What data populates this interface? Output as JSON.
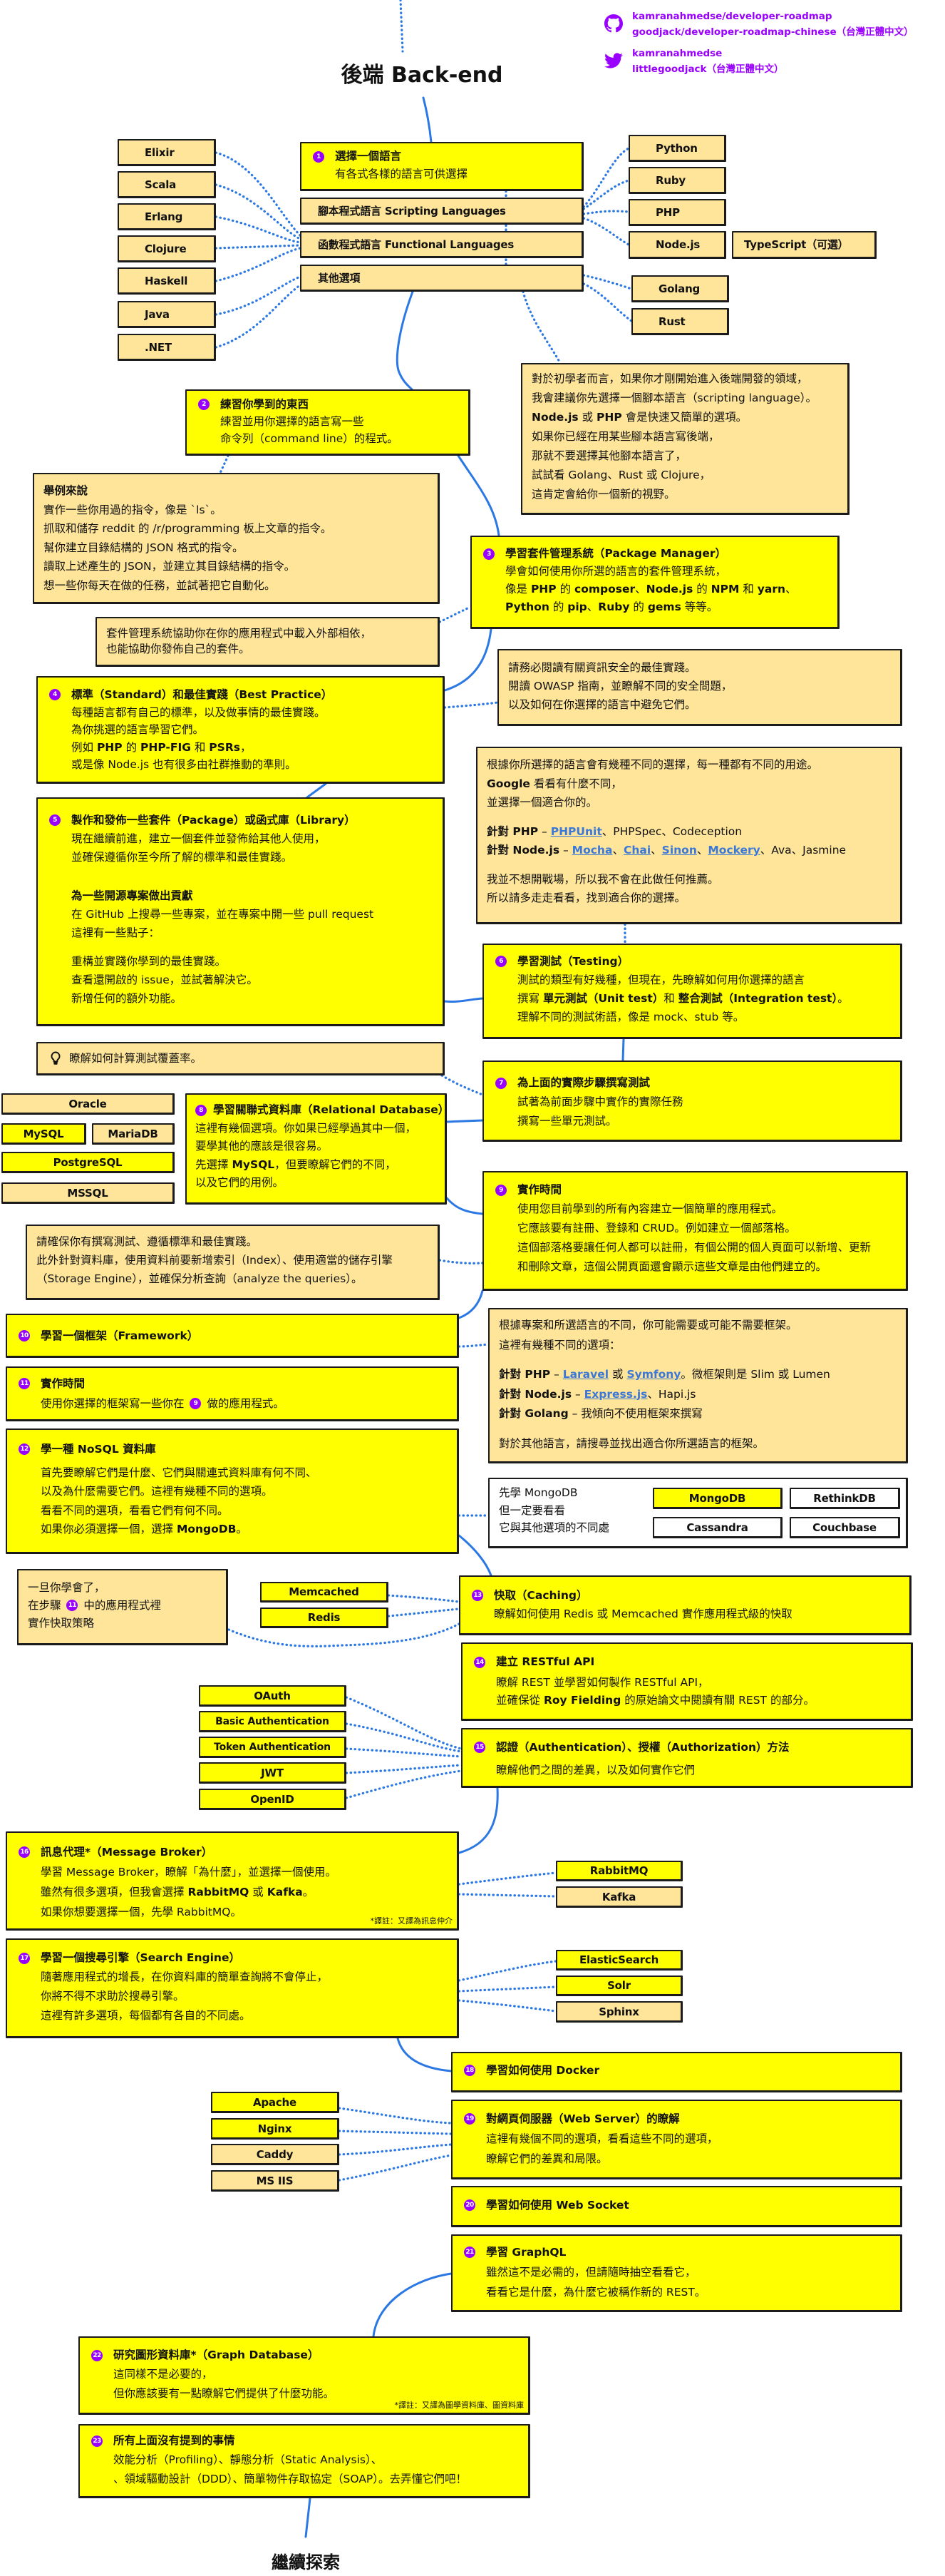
{
  "colors": {
    "recommended": "#ffff00",
    "alternative": "#ffe599",
    "other": "#ffffff",
    "badge_purple": "#9900ff",
    "link_blue": "#3c78d8",
    "connector_blue": "#2b78e4"
  },
  "header": {
    "title": "後端 Back-end",
    "github": [
      "kamranahmedse/developer-roadmap",
      "goodjack/developer-roadmap-chinese（台灣正體中文）"
    ],
    "twitter": [
      "kamranahmedse",
      "littlegoodjack（台灣正體中文）"
    ]
  },
  "footer": {
    "title": "繼續探索"
  },
  "languages": {
    "groups": [
      {
        "label": "腳本程式語言 Scripting Languages",
        "status": "alternative"
      },
      {
        "label": "函數程式語言 Functional Languages",
        "status": "alternative"
      },
      {
        "label": "其他選項",
        "status": "alternative"
      }
    ],
    "left": [
      {
        "label": "Elixir",
        "status": "alternative"
      },
      {
        "label": "Scala",
        "status": "alternative"
      },
      {
        "label": "Erlang",
        "status": "alternative"
      },
      {
        "label": "Clojure",
        "status": "alternative"
      },
      {
        "label": "Haskell",
        "status": "alternative"
      },
      {
        "label": "Java",
        "status": "alternative"
      },
      {
        "label": ".NET",
        "status": "alternative"
      }
    ],
    "right": [
      {
        "label": "Python",
        "status": "alternative"
      },
      {
        "label": "Ruby",
        "status": "alternative"
      },
      {
        "label": "PHP",
        "status": "alternative"
      },
      {
        "label": "Node.js",
        "status": "alternative"
      },
      {
        "label": "Golang",
        "status": "alternative"
      },
      {
        "label": "Rust",
        "status": "alternative"
      }
    ],
    "typescript": {
      "label": "TypeScript（可選）",
      "status": "alternative"
    }
  },
  "relational_dbs": [
    {
      "label": "Oracle",
      "status": "alternative"
    },
    {
      "label": "MySQL",
      "status": "recommended"
    },
    {
      "label": "MariaDB",
      "status": "alternative"
    },
    {
      "label": "PostgreSQL",
      "status": "recommended"
    },
    {
      "label": "MSSQL",
      "status": "alternative"
    }
  ],
  "nosql_dbs": [
    {
      "label": "MongoDB",
      "status": "recommended"
    },
    {
      "label": "RethinkDB",
      "status": "other"
    },
    {
      "label": "Cassandra",
      "status": "other"
    },
    {
      "label": "Couchbase",
      "status": "other"
    }
  ],
  "caches": [
    {
      "label": "Memcached",
      "status": "recommended"
    },
    {
      "label": "Redis",
      "status": "recommended"
    }
  ],
  "auth_methods": [
    {
      "label": "OAuth",
      "status": "recommended"
    },
    {
      "label": "Basic Authentication",
      "status": "recommended"
    },
    {
      "label": "Token Authentication",
      "status": "recommended"
    },
    {
      "label": "JWT",
      "status": "recommended"
    },
    {
      "label": "OpenID",
      "status": "recommended"
    }
  ],
  "message_brokers": [
    {
      "label": "RabbitMQ",
      "status": "recommended"
    },
    {
      "label": "Kafka",
      "status": "alternative"
    }
  ],
  "search_engines": [
    {
      "label": "ElasticSearch",
      "status": "recommended"
    },
    {
      "label": "Solr",
      "status": "recommended"
    },
    {
      "label": "Sphinx",
      "status": "alternative"
    }
  ],
  "web_servers": [
    {
      "label": "Apache",
      "status": "recommended"
    },
    {
      "label": "Nginx",
      "status": "recommended"
    },
    {
      "label": "Caddy",
      "status": "alternative"
    },
    {
      "label": "MS IIS",
      "status": "alternative"
    }
  ],
  "steps": [
    {
      "number": "1",
      "title": "選擇一個語言",
      "body": [
        "有各式各樣的語言可供選擇"
      ]
    },
    {
      "number": "2",
      "title": "練習你學到的東西",
      "body": [
        "練習並用你選擇的語言寫一些",
        "命令列（command line）的程式。"
      ]
    },
    {
      "number": "3",
      "title": "學習套件管理系統（Package Manager）",
      "body": [
        "學會如何使用你所選的語言的套件管理系統，",
        [
          "像是 ",
          {
            "b": "PHP"
          },
          " 的 ",
          {
            "b": "composer"
          },
          "、",
          {
            "b": "Node.js"
          },
          " 的 ",
          {
            "b": "NPM"
          },
          " 和 ",
          {
            "b": "yarn"
          },
          "、"
        ],
        [
          {
            "b": "Python"
          },
          " 的 ",
          {
            "b": "pip"
          },
          "、",
          {
            "b": "Ruby"
          },
          " 的 ",
          {
            "b": "gems"
          },
          " 等等。"
        ]
      ]
    },
    {
      "number": "4",
      "title": "標準（Standard）和最佳實踐（Best Practice）",
      "body": [
        "每種語言都有自己的標準，以及做事情的最佳實踐。",
        "為你挑選的語言學習它們。",
        [
          "例如 ",
          {
            "b": "PHP"
          },
          " 的 ",
          {
            "b": "PHP-FIG"
          },
          " 和 ",
          {
            "b": "PSRs"
          },
          "，"
        ],
        "或是像 Node.js 也有很多由社群推動的準則。"
      ]
    },
    {
      "number": "5",
      "title": "製作和發佈一些套件（Package）或函式庫（Library）",
      "body": [
        "現在繼續前進，建立一個套件並發佈給其他人使用，",
        "並確保遵循你至今所了解的標準和最佳實踐。",
        "",
        "",
        [
          {
            "b": "為一些開源專案做出貢獻"
          }
        ],
        "在 GitHub 上搜尋一些專案，並在專案中開一些 pull request",
        "這裡有一些點子：",
        "",
        "重構並實踐你學到的最佳實踐。",
        "查看還開啟的 issue，並試著解決它。",
        "新增任何的額外功能。"
      ]
    },
    {
      "number": "6",
      "title": "學習測試（Testing）",
      "body": [
        "測試的類型有好幾種，但現在，先瞭解如何用你選擇的語言",
        [
          "撰寫 ",
          {
            "b": "單元測試（Unit test）"
          },
          "和 ",
          {
            "b": "整合測試（Integration test）"
          },
          "。"
        ],
        "理解不同的測試術語，像是 mock、stub 等。"
      ]
    },
    {
      "number": "7",
      "title": "為上面的實際步驟撰寫測試",
      "body": [
        "試著為前面步驟中實作的實際任務",
        "撰寫一些單元測試。"
      ]
    },
    {
      "number": "8",
      "title": "學習關聯式資料庫（Relational Database）",
      "body": [
        "這裡有幾個選項。你如果已經學過其中一個，",
        "要學其他的應該是很容易。",
        [
          "先選擇 ",
          {
            "b": "MySQL"
          },
          "，但要瞭解它們的不同，"
        ],
        "以及它們的用例。"
      ]
    },
    {
      "number": "9",
      "title": "實作時間",
      "body": [
        "使用您目前學到的所有內容建立一個簡單的應用程式。",
        "它應該要有註冊、登錄和 CRUD。例如建立一個部落格。",
        "這個部落格要讓任何人都可以註冊，有個公開的個人頁面可以新增、更新",
        "和刪除文章，這個公開頁面還會顯示這些文章是由他們建立的。"
      ]
    },
    {
      "number": "10",
      "title": "學習一個框架（Framework）",
      "body": []
    },
    {
      "number": "11",
      "title": "實作時間",
      "body": [
        [
          "使用你選擇的框架寫一些你在 ",
          {
            "badge": "9"
          },
          " 做的應用程式。"
        ]
      ]
    },
    {
      "number": "12",
      "title": "學一種 NoSQL 資料庫",
      "body": [
        "首先要瞭解它們是什麼、它們與關連式資料庫有何不同、",
        "以及為什麼需要它們。這裡有幾種不同的選項。",
        "看看不同的選項，看看它們有何不同。",
        [
          "如果你必須選擇一個，選擇 ",
          {
            "b": "MongoDB"
          },
          "。"
        ]
      ]
    },
    {
      "number": "13",
      "title": "快取（Caching）",
      "body": [
        "瞭解如何使用 Redis 或 Memcached 實作應用程式級的快取"
      ]
    },
    {
      "number": "14",
      "title": "建立 RESTful API",
      "body": [
        "瞭解 REST 並學習如何製作 RESTful API，",
        [
          "並確保從 ",
          {
            "b": "Roy Fielding"
          },
          " 的原始論文中閱讀有關 REST 的部分。"
        ]
      ]
    },
    {
      "number": "15",
      "title": "認證（Authentication）、授權（Authorization）方法",
      "body": [
        "瞭解他們之間的差異，以及如何實作它們"
      ]
    },
    {
      "number": "16",
      "title": "訊息代理*（Message Broker）",
      "body": [
        "學習 Message Broker，瞭解「為什麼」，並選擇一個使用。",
        [
          "雖然有很多選項，但我會選擇 ",
          {
            "b": "RabbitMQ"
          },
          " 或 ",
          {
            "b": "Kafka"
          },
          "。"
        ],
        "如果你想要選擇一個，先學 RabbitMQ。"
      ],
      "footnote": "*譯註：又譯為訊息仲介"
    },
    {
      "number": "17",
      "title": "學習一個搜尋引擎（Search Engine）",
      "body": [
        "隨著應用程式的增長，在你資料庫的簡單查詢將不會停止，",
        "你將不得不求助於搜尋引擎。",
        "這裡有許多選項，每個都有各自的不同處。"
      ]
    },
    {
      "number": "18",
      "title": "學習如何使用 Docker",
      "body": []
    },
    {
      "number": "19",
      "title": "對網頁伺服器（Web Server）的瞭解",
      "body": [
        "這裡有幾個不同的選項，看看這些不同的選項，",
        "瞭解它們的差異和局限。"
      ]
    },
    {
      "number": "20",
      "title": "學習如何使用 Web Socket",
      "body": []
    },
    {
      "number": "21",
      "title": "學習 GraphQL",
      "body": [
        "雖然這不是必需的，但請隨時抽空看看它，",
        "看看它是什麼，為什麼它被稱作新的 REST。"
      ]
    },
    {
      "number": "22",
      "title": "研究圖形資料庫*（Graph Database）",
      "body": [
        "這同樣不是必要的，",
        "但你應該要有一點瞭解它們提供了什麼功能。"
      ],
      "footnote": "*譯註：又譯為圖學資料庫、圖資料庫"
    },
    {
      "number": "23",
      "title": "所有上面沒有提到的事情",
      "body": [
        "效能分析（Profiling）、靜態分析（Static Analysis）、",
        "、領域驅動設計（DDD）、簡單物件存取協定（SOAP）。去弄懂它們吧！"
      ]
    }
  ],
  "notes": {
    "beginner": [
      "對於初學者而言，如果你才剛開始進入後端開發的領域，",
      "我會建議你先選擇一個腳本語言（scripting language）。",
      [
        {
          "b": "Node.js"
        },
        " 或 ",
        {
          "b": "PHP"
        },
        " 會是快速又簡單的選項。"
      ],
      "如果你已經在用某些腳本語言寫後端，",
      "那就不要選擇其他腳本語言了，",
      "試試看 Golang、Rust 或 Clojure，",
      "這肯定會給你一個新的視野。"
    ],
    "cli_examples": [
      [
        {
          "b": "舉例來說"
        }
      ],
      "實作一些你用過的指令，像是 `ls`。",
      "抓取和儲存 reddit 的 /r/programming 板上文章的指令。",
      "幫你建立目錄結構的 JSON 格式的指令。",
      "讀取上述產生的 JSON，並建立其目錄結構的指令。",
      "想一些你每天在做的任務，並試著把它自動化。"
    ],
    "package_manager": [
      "套件管理系統協助你在你的應用程式中載入外部相依，",
      "也能協助你發佈自己的套件。"
    ],
    "security": [
      "請務必閱讀有關資訊安全的最佳實踐。",
      "閱讀 OWASP 指南，並瞭解不同的安全問題，",
      "以及如何在你選擇的語言中避免它們。"
    ],
    "testing_tools": [
      "根據你所選擇的語言會有幾種不同的選擇，每一種都有不同的用途。",
      [
        {
          "b": "Google"
        },
        " 看看有什麼不同，"
      ],
      "並選擇一個適合你的。",
      "",
      [
        {
          "b": "針對 PHP"
        },
        " – ",
        {
          "a": "PHPUnit"
        },
        "、PHPSpec、Codeception"
      ],
      [
        {
          "b": "針對 Node.js"
        },
        " – ",
        {
          "a": "Mocha"
        },
        "、",
        {
          "a": "Chai"
        },
        "、",
        {
          "a": "Sinon"
        },
        "、",
        {
          "a": "Mockery"
        },
        "、Ava、Jasmine"
      ],
      "",
      "我並不想開戰場，所以我不會在此做任何推薦。",
      "所以請多走走看看，找到適合你的選擇。"
    ],
    "coverage": "瞭解如何計算測試覆蓋率。",
    "database": [
      "請確保你有撰寫測試、遵循標準和最佳實踐。",
      "此外針對資料庫，使用資料前要新增索引（Index）、使用適當的儲存引擎",
      "（Storage Engine），並確保分析查詢（analyze the queries）。"
    ],
    "framework": [
      "根據專案和所選語言的不同，你可能需要或可能不需要框架。",
      "這裡有幾種不同的選項：",
      "",
      [
        {
          "b": "針對 PHP"
        },
        " – ",
        {
          "a": "Laravel"
        },
        " 或 ",
        {
          "a": "Symfony"
        },
        "。微框架則是 Slim 或 Lumen"
      ],
      [
        {
          "b": "針對 Node.js"
        },
        " – ",
        {
          "a": "Express.js"
        },
        "、Hapi.js"
      ],
      [
        {
          "b": "針對 Golang"
        },
        " – 我傾向不使用框架來撰寫"
      ],
      "",
      "對於其他語言，請搜尋並找出適合你所選語言的框架。"
    ],
    "nosql": [
      "先學 MongoDB",
      "但一定要看看",
      "它與其他選項的不同處"
    ],
    "caching": [
      "一旦你學會了，",
      [
        "在步驟 ",
        {
          "badge": "11"
        },
        " 中的應用程式裡"
      ],
      "實作快取策略"
    ]
  }
}
